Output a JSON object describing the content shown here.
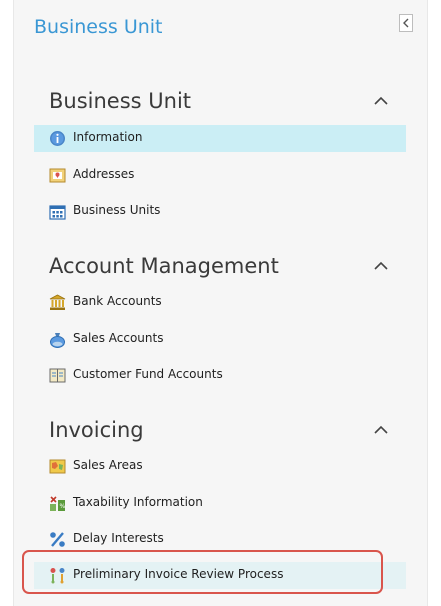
{
  "panel": {
    "title": "Business Unit"
  },
  "sections": [
    {
      "title": "Business Unit",
      "items": [
        {
          "label": "Information",
          "icon": "info-icon",
          "selected": true
        },
        {
          "label": "Addresses",
          "icon": "address-card-icon"
        },
        {
          "label": "Business Units",
          "icon": "building-icon"
        }
      ]
    },
    {
      "title": "Account Management",
      "items": [
        {
          "label": "Bank Accounts",
          "icon": "bank-icon"
        },
        {
          "label": "Sales Accounts",
          "icon": "money-bag-icon"
        },
        {
          "label": "Customer Fund Accounts",
          "icon": "ledger-icon"
        }
      ]
    },
    {
      "title": "Invoicing",
      "items": [
        {
          "label": "Sales Areas",
          "icon": "map-icon"
        },
        {
          "label": "Taxability Information",
          "icon": "tax-icon"
        },
        {
          "label": "Delay Interests",
          "icon": "percent-icon"
        },
        {
          "label": "Preliminary Invoice Review Process",
          "icon": "process-icon"
        }
      ]
    }
  ],
  "colors": {
    "title_blue": "#3a97d4",
    "selected_bg": "#cbeef5",
    "highlight_border": "#d9554c"
  }
}
